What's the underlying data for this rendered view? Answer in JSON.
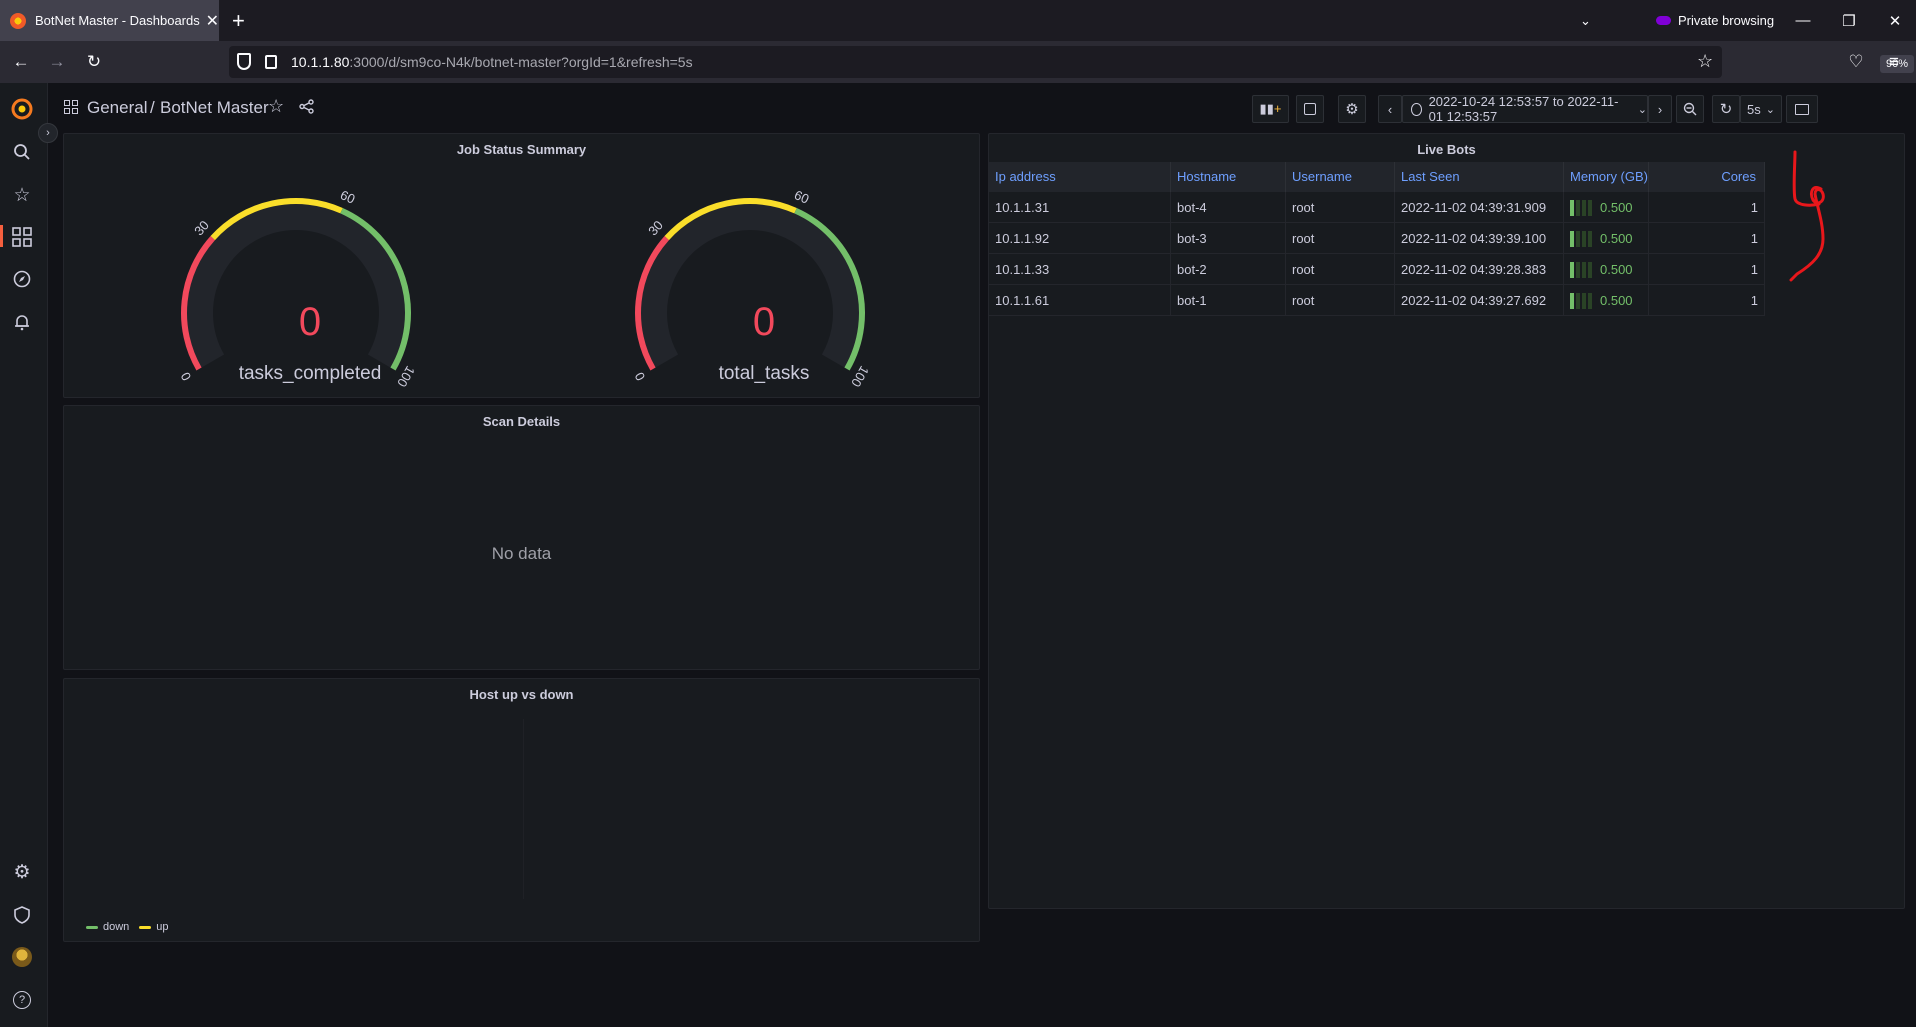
{
  "browser": {
    "tab_title": "BotNet Master - Dashboards - G",
    "new_tab": "+",
    "private_label": "Private browsing",
    "url_host": "10.1.1.80",
    "url_rest": ":3000/d/sm9co-N4k/botnet-master?orgId=1&refresh=5s",
    "zoom": "90%"
  },
  "breadcrumb": {
    "folder": "General",
    "separator": "/",
    "dashboard": "BotNet Master"
  },
  "toolbar": {
    "time_range": "2022-10-24 12:53:57 to 2022-11-01 12:53:57",
    "refresh": "5s"
  },
  "panels": {
    "job_status": {
      "title": "Job Status Summary",
      "gauges": [
        {
          "value": "0",
          "name": "tasks_completed",
          "ticks": [
            "0",
            "30",
            "60",
            "100"
          ],
          "min": 0,
          "max": 100
        },
        {
          "value": "0",
          "name": "total_tasks",
          "ticks": [
            "0",
            "30",
            "60",
            "100"
          ],
          "min": 0,
          "max": 100
        }
      ],
      "threshold_colors": [
        "#f2495c",
        "#fade2a",
        "#73bf69"
      ]
    },
    "scan_details": {
      "title": "Scan Details",
      "empty": "No data"
    },
    "host_updown": {
      "title": "Host up vs down",
      "legend": [
        {
          "label": "down",
          "color": "#73bf69"
        },
        {
          "label": "up",
          "color": "#fade2a"
        }
      ]
    },
    "live_bots": {
      "title": "Live Bots",
      "columns": [
        "Ip address",
        "Hostname",
        "Username",
        "Last Seen",
        "Memory (GB)",
        "Cores"
      ],
      "rows": [
        {
          "ip": "10.1.1.31",
          "host": "bot-4",
          "user": "root",
          "seen": "2022-11-02 04:39:31.909",
          "mem": "0.500",
          "mem_fraction": 0.25,
          "cores": "1"
        },
        {
          "ip": "10.1.1.92",
          "host": "bot-3",
          "user": "root",
          "seen": "2022-11-02 04:39:39.100",
          "mem": "0.500",
          "mem_fraction": 0.25,
          "cores": "1"
        },
        {
          "ip": "10.1.1.33",
          "host": "bot-2",
          "user": "root",
          "seen": "2022-11-02 04:39:28.383",
          "mem": "0.500",
          "mem_fraction": 0.25,
          "cores": "1"
        },
        {
          "ip": "10.1.1.61",
          "host": "bot-1",
          "user": "root",
          "seen": "2022-11-02 04:39:27.692",
          "mem": "0.500",
          "mem_fraction": 0.25,
          "cores": "1"
        }
      ]
    }
  }
}
